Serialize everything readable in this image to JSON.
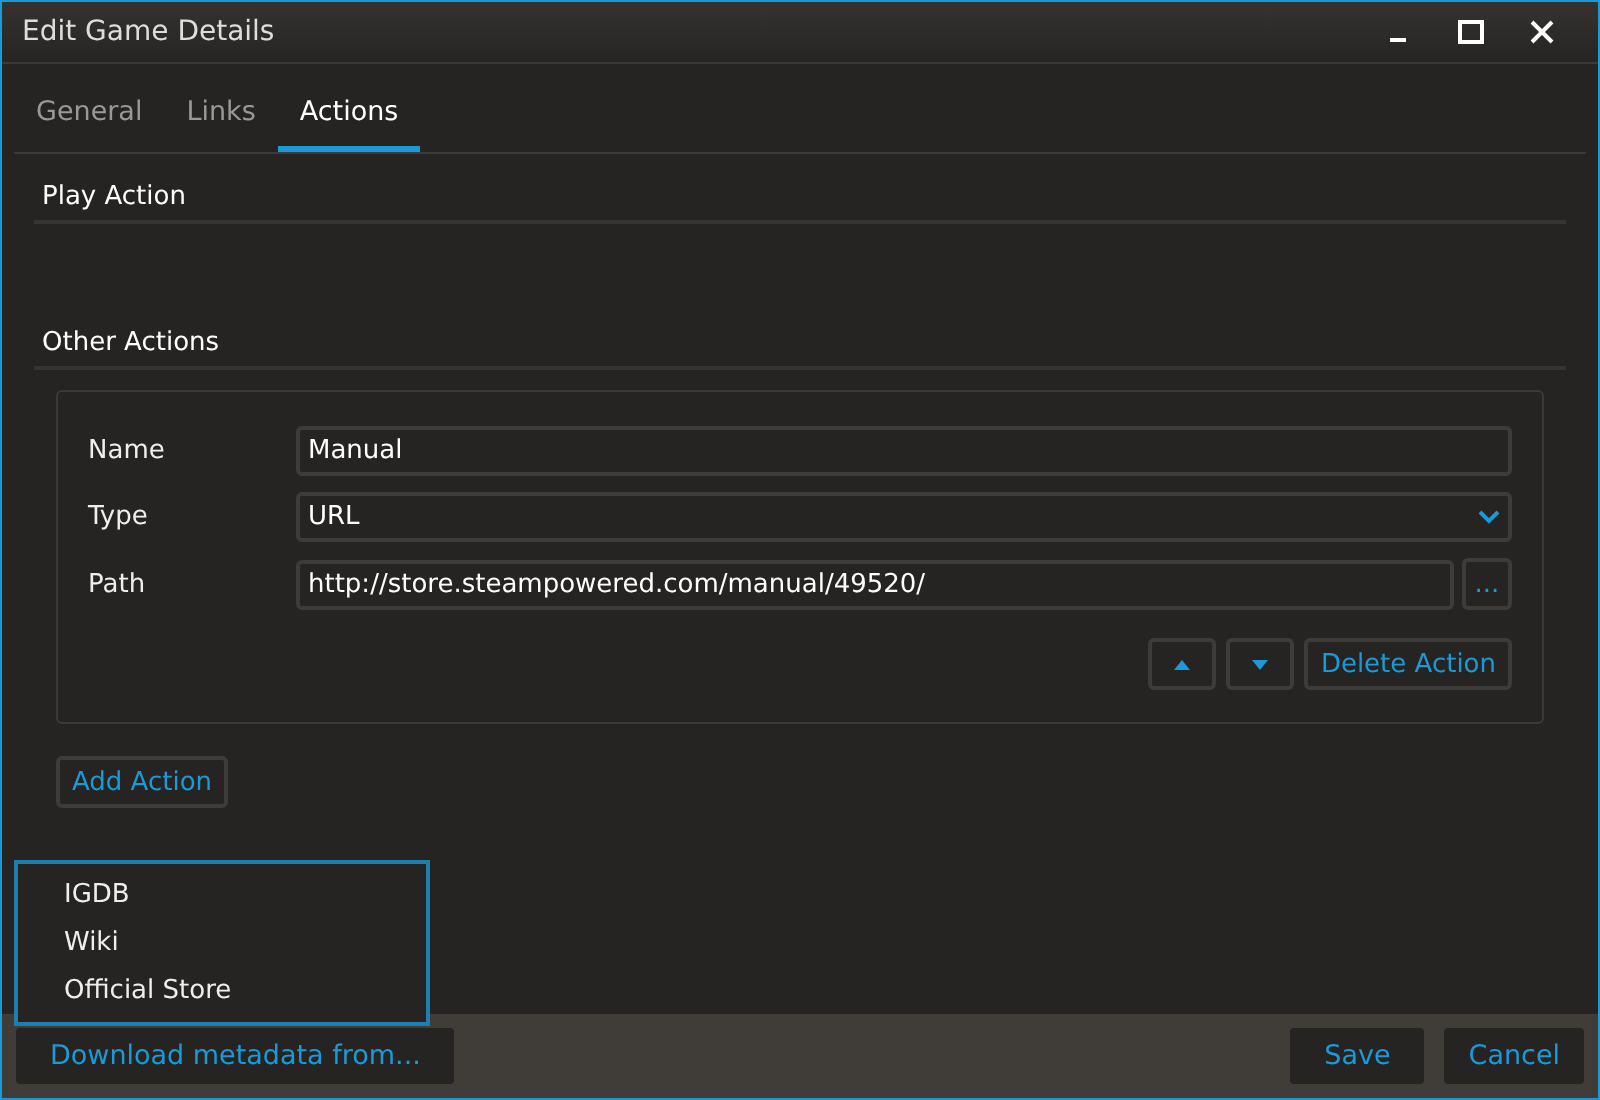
{
  "window": {
    "title": "Edit Game Details"
  },
  "tabs": [
    {
      "label": "General",
      "selected": false
    },
    {
      "label": "Links",
      "selected": false
    },
    {
      "label": "Actions",
      "selected": true
    }
  ],
  "play_action": {
    "heading": "Play Action"
  },
  "other_actions": {
    "heading": "Other Actions",
    "fields": [
      {
        "kind": "text",
        "label": "Name",
        "value": "Manual"
      },
      {
        "kind": "select",
        "label": "Type",
        "value": "URL"
      },
      {
        "kind": "path",
        "label": "Path",
        "value": "http://store.steampowered.com/manual/49520/",
        "browse": "..."
      }
    ],
    "delete_button": "Delete Action"
  },
  "add_button": "Add Action",
  "metadata_menu": {
    "items": [
      "IGDB",
      "Wiki",
      "Official Store"
    ]
  },
  "footer": {
    "download_button": "Download metadata from...",
    "save_button": "Save",
    "cancel_button": "Cancel"
  }
}
